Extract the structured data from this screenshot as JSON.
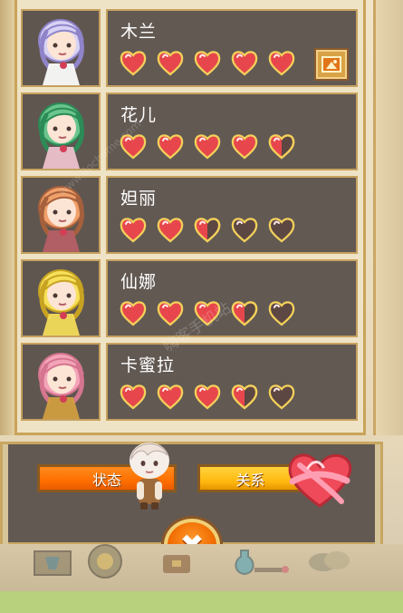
{
  "characters": [
    {
      "name": "木兰",
      "hearts": [
        "full",
        "full",
        "full",
        "full",
        "full"
      ],
      "portrait": "white-haired-maid-portrait",
      "has_image_button": true,
      "image_button_icon": "picture-icon"
    },
    {
      "name": "花儿",
      "hearts": [
        "full",
        "full",
        "full",
        "full",
        "half"
      ],
      "portrait": "green-haired-glasses-portrait",
      "has_image_button": false,
      "image_button_icon": ""
    },
    {
      "name": "妲丽",
      "hearts": [
        "full",
        "full",
        "half",
        "empty",
        "empty"
      ],
      "portrait": "orange-haired-portrait",
      "has_image_button": false,
      "image_button_icon": ""
    },
    {
      "name": "仙娜",
      "hearts": [
        "full",
        "full",
        "full",
        "half",
        "empty"
      ],
      "portrait": "blonde-bow-portrait",
      "has_image_button": false,
      "image_button_icon": ""
    },
    {
      "name": "卡蜜拉",
      "hearts": [
        "full",
        "full",
        "full",
        "half",
        "empty"
      ],
      "portrait": "pink-haired-portrait",
      "has_image_button": false,
      "image_button_icon": ""
    }
  ],
  "tabs": {
    "status": "状态",
    "relation": "关系"
  },
  "watermark_text": "www.9ochome.com",
  "watermark_cn": "嗨客手机站",
  "colors": {
    "panel_bg": "#625953",
    "frame_gold": "#c9a35a",
    "heart_red": "#e7474c",
    "heart_empty": "#5d4743",
    "heart_outline": "#f3d15a",
    "status_orange": "#ff7200",
    "relation_yellow": "#ffbd16",
    "close_orange": "#f06c00"
  },
  "icons": {
    "close": "close-icon",
    "heart": "heart-icon",
    "picture": "picture-icon"
  }
}
